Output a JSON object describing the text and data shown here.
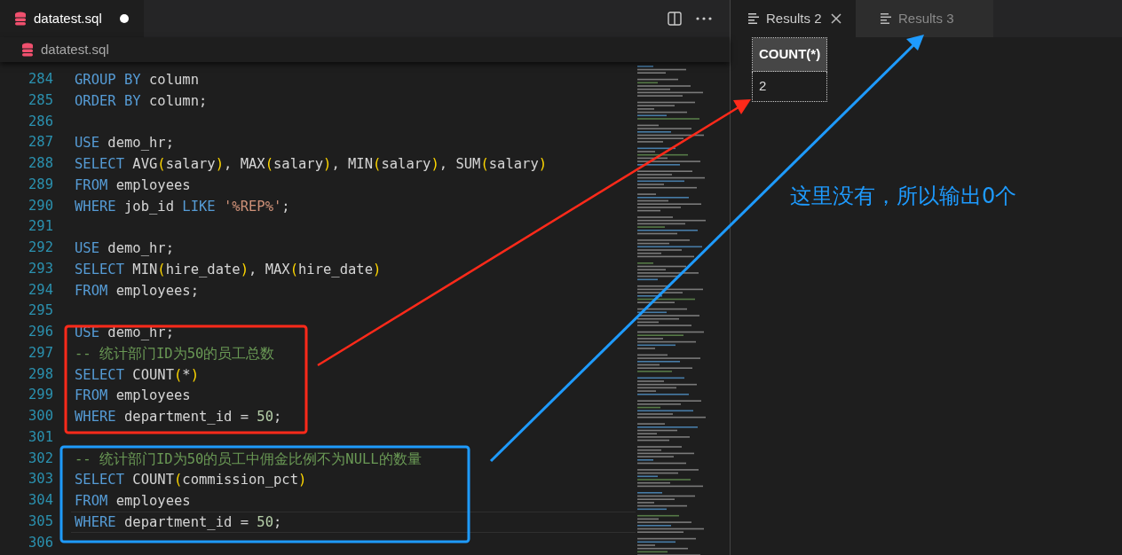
{
  "editor_tab": {
    "title": "datatest.sql",
    "modified": true
  },
  "breadcrumb": "datatest.sql",
  "code_lines": [
    {
      "number": "284",
      "current": false,
      "tokens": [
        {
          "kind": "keyword",
          "text": "GROUP BY"
        },
        {
          "kind": "plain",
          "text": " column"
        }
      ]
    },
    {
      "number": "285",
      "current": false,
      "tokens": [
        {
          "kind": "keyword",
          "text": "ORDER BY"
        },
        {
          "kind": "plain",
          "text": " column;"
        }
      ]
    },
    {
      "number": "286",
      "current": false
    },
    {
      "number": "287",
      "current": false,
      "tokens": [
        {
          "kind": "keyword",
          "text": "USE"
        },
        {
          "kind": "plain",
          "text": " demo_hr;"
        }
      ]
    },
    {
      "number": "288",
      "current": false,
      "tokens": [
        {
          "kind": "keyword",
          "text": "SELECT"
        },
        {
          "kind": "plain",
          "text": " AVG"
        },
        {
          "kind": "paren",
          "text": "("
        },
        {
          "kind": "plain",
          "text": "salary"
        },
        {
          "kind": "paren",
          "text": ")"
        },
        {
          "kind": "plain",
          "text": ", MAX"
        },
        {
          "kind": "paren",
          "text": "("
        },
        {
          "kind": "plain",
          "text": "salary"
        },
        {
          "kind": "paren",
          "text": ")"
        },
        {
          "kind": "plain",
          "text": ", MIN"
        },
        {
          "kind": "paren",
          "text": "("
        },
        {
          "kind": "plain",
          "text": "salary"
        },
        {
          "kind": "paren",
          "text": ")"
        },
        {
          "kind": "plain",
          "text": ", SUM"
        },
        {
          "kind": "paren",
          "text": "("
        },
        {
          "kind": "plain",
          "text": "salary"
        },
        {
          "kind": "paren",
          "text": ")"
        }
      ]
    },
    {
      "number": "289",
      "current": false,
      "tokens": [
        {
          "kind": "keyword",
          "text": "FROM"
        },
        {
          "kind": "plain",
          "text": " employees"
        }
      ]
    },
    {
      "number": "290",
      "current": false,
      "tokens": [
        {
          "kind": "keyword",
          "text": "WHERE"
        },
        {
          "kind": "plain",
          "text": " job_id "
        },
        {
          "kind": "keyword",
          "text": "LIKE"
        },
        {
          "kind": "string",
          "text": " '%REP%'"
        },
        {
          "kind": "plain",
          "text": ";"
        }
      ]
    },
    {
      "number": "291",
      "current": false
    },
    {
      "number": "292",
      "current": false,
      "tokens": [
        {
          "kind": "keyword",
          "text": "USE"
        },
        {
          "kind": "plain",
          "text": " demo_hr;"
        }
      ]
    },
    {
      "number": "293",
      "current": false,
      "tokens": [
        {
          "kind": "keyword",
          "text": "SELECT"
        },
        {
          "kind": "plain",
          "text": " MIN"
        },
        {
          "kind": "paren",
          "text": "("
        },
        {
          "kind": "plain",
          "text": "hire_date"
        },
        {
          "kind": "paren",
          "text": ")"
        },
        {
          "kind": "plain",
          "text": ", MAX"
        },
        {
          "kind": "paren",
          "text": "("
        },
        {
          "kind": "plain",
          "text": "hire_date"
        },
        {
          "kind": "paren",
          "text": ")"
        }
      ]
    },
    {
      "number": "294",
      "current": false,
      "tokens": [
        {
          "kind": "keyword",
          "text": "FROM"
        },
        {
          "kind": "plain",
          "text": " employees;"
        }
      ]
    },
    {
      "number": "295",
      "current": false
    },
    {
      "number": "296",
      "current": false,
      "tokens": [
        {
          "kind": "keyword",
          "text": "USE"
        },
        {
          "kind": "plain",
          "text": " demo_hr;"
        }
      ]
    },
    {
      "number": "297",
      "current": false,
      "tokens": [
        {
          "kind": "comment",
          "text": "-- 统计部门ID为50的员工总数"
        }
      ]
    },
    {
      "number": "298",
      "current": false,
      "tokens": [
        {
          "kind": "keyword",
          "text": "SELECT"
        },
        {
          "kind": "plain",
          "text": " COUNT"
        },
        {
          "kind": "paren",
          "text": "("
        },
        {
          "kind": "plain",
          "text": "*"
        },
        {
          "kind": "paren",
          "text": ")"
        }
      ]
    },
    {
      "number": "299",
      "current": false,
      "tokens": [
        {
          "kind": "keyword",
          "text": "FROM"
        },
        {
          "kind": "plain",
          "text": " employees"
        }
      ]
    },
    {
      "number": "300",
      "current": false,
      "tokens": [
        {
          "kind": "keyword",
          "text": "WHERE"
        },
        {
          "kind": "plain",
          "text": " department_id = "
        },
        {
          "kind": "number",
          "text": "50"
        },
        {
          "kind": "plain",
          "text": ";"
        }
      ]
    },
    {
      "number": "301",
      "current": false
    },
    {
      "number": "302",
      "current": false,
      "tokens": [
        {
          "kind": "comment",
          "text": "-- 统计部门ID为50的员工中佣金比例不为NULL的数量"
        }
      ]
    },
    {
      "number": "303",
      "current": false,
      "tokens": [
        {
          "kind": "keyword",
          "text": "SELECT"
        },
        {
          "kind": "plain",
          "text": " COUNT"
        },
        {
          "kind": "paren",
          "text": "("
        },
        {
          "kind": "plain",
          "text": "commission_pct"
        },
        {
          "kind": "paren",
          "text": ")"
        }
      ]
    },
    {
      "number": "304",
      "current": false,
      "tokens": [
        {
          "kind": "keyword",
          "text": "FROM"
        },
        {
          "kind": "plain",
          "text": " employees"
        }
      ]
    },
    {
      "number": "305",
      "current": true,
      "tokens": [
        {
          "kind": "keyword",
          "text": "WHERE"
        },
        {
          "kind": "plain",
          "text": " department_id = "
        },
        {
          "kind": "number",
          "text": "50"
        },
        {
          "kind": "plain",
          "text": ";"
        }
      ]
    },
    {
      "number": "306",
      "current": false
    }
  ],
  "results_tabs": [
    {
      "label": "Results 2",
      "selected": true
    },
    {
      "label": "Results 3",
      "selected": false
    }
  ],
  "result_table": {
    "columns": [
      "COUNT(*)"
    ],
    "rows": [
      [
        "2"
      ]
    ]
  },
  "annotation": {
    "text": "这里没有，所以输出0个"
  }
}
